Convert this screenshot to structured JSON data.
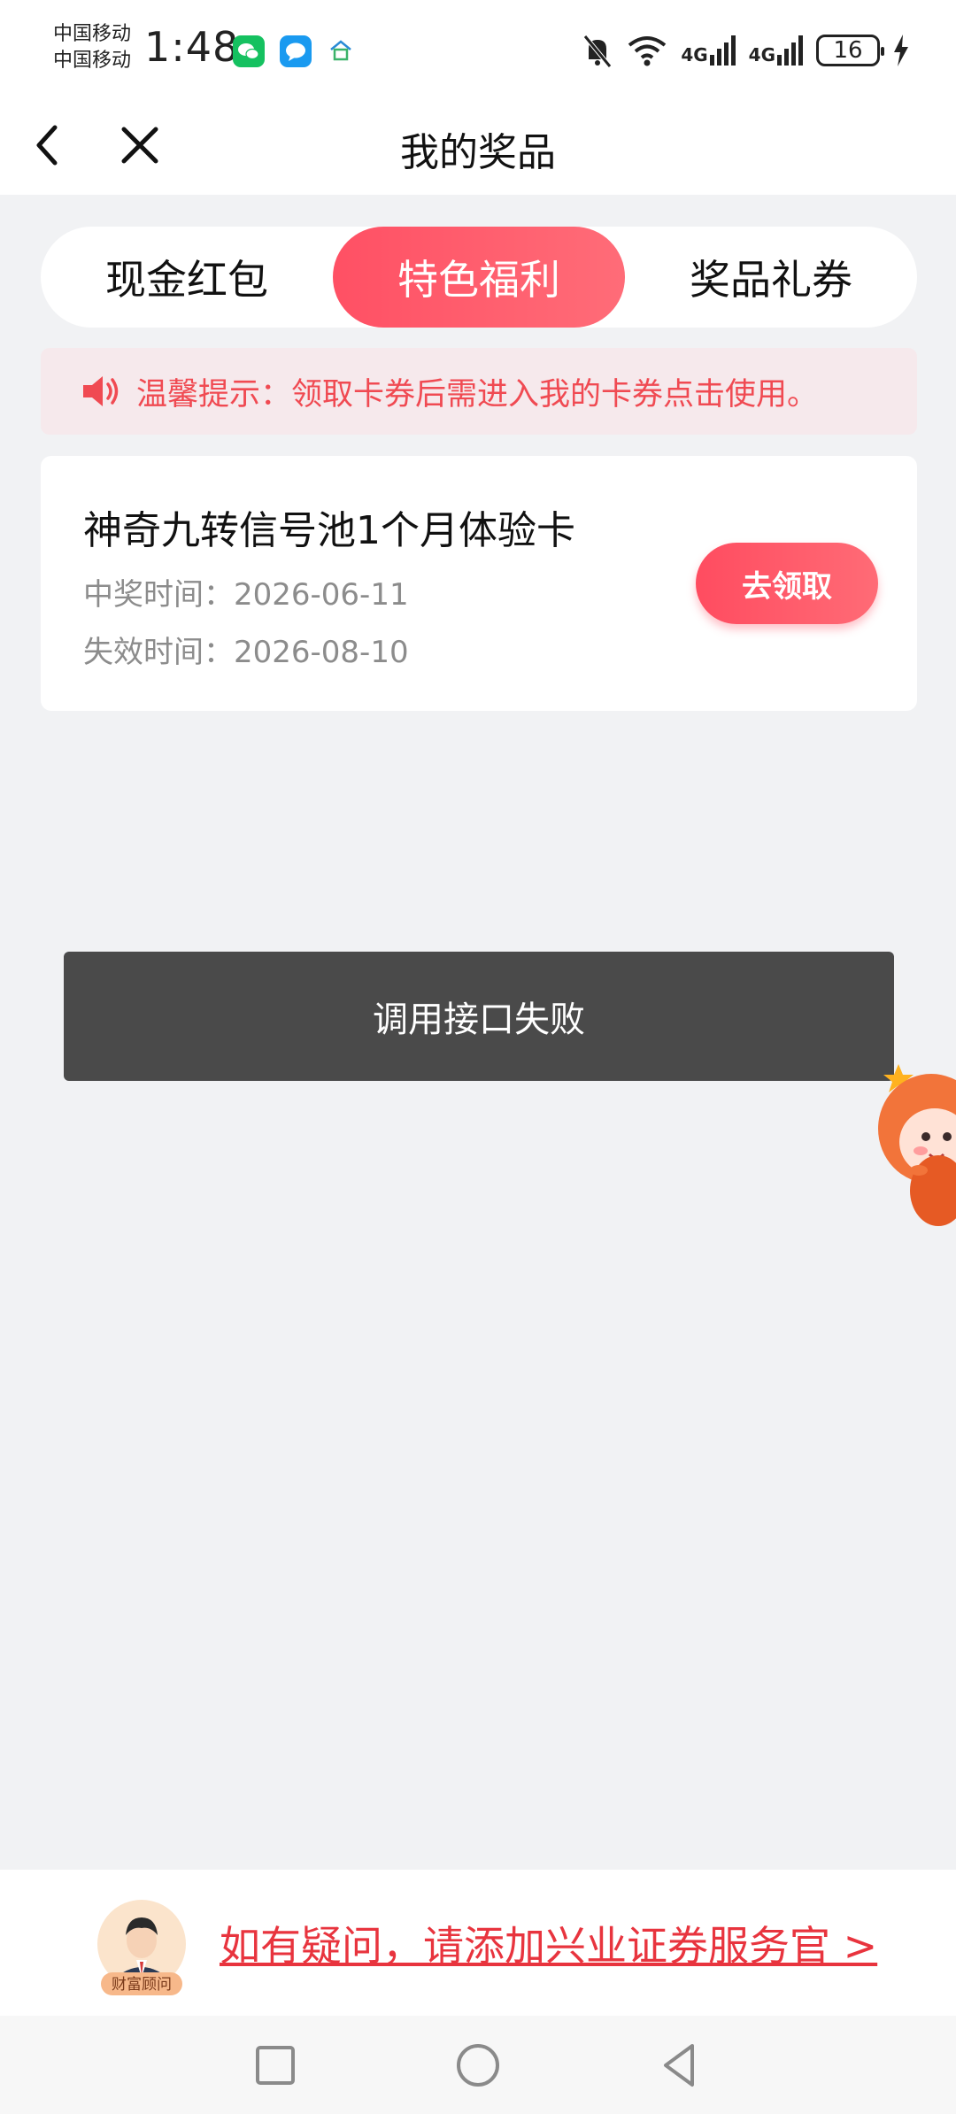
{
  "status_bar": {
    "carrier_1": "中国移动",
    "carrier_2": "中国移动",
    "time": "1:48",
    "signal_1": "4G",
    "signal_2": "4G",
    "battery": "16"
  },
  "header": {
    "title": "我的奖品",
    "back_icon": "chevron-left-icon",
    "close_icon": "close-icon"
  },
  "tabs": [
    {
      "label": "现金红包",
      "active": false
    },
    {
      "label": "特色福利",
      "active": true
    },
    {
      "label": "奖品礼券",
      "active": false
    }
  ],
  "notice": {
    "text": "温馨提示：领取卡券后需进入我的卡券点击使用。",
    "icon": "speaker-icon"
  },
  "prize": {
    "name": "神奇九转信号池1个月体验卡",
    "win_time": "中奖时间：2026-06-11",
    "expire_time": "失效时间：2026-08-10",
    "button_label": "去领取"
  },
  "toast": {
    "text": "调用接口失败"
  },
  "service": {
    "avatar_label": "财富顾问",
    "link_text": "如有疑问，请添加兴业证券服务官 >"
  },
  "colors": {
    "accent": "#ff5064",
    "notice_bg": "#f6e9ec",
    "notice_text": "#f04a52",
    "page_bg": "#f1f2f4",
    "toast_bg": "#4a4a4a",
    "link": "#e8343e"
  }
}
